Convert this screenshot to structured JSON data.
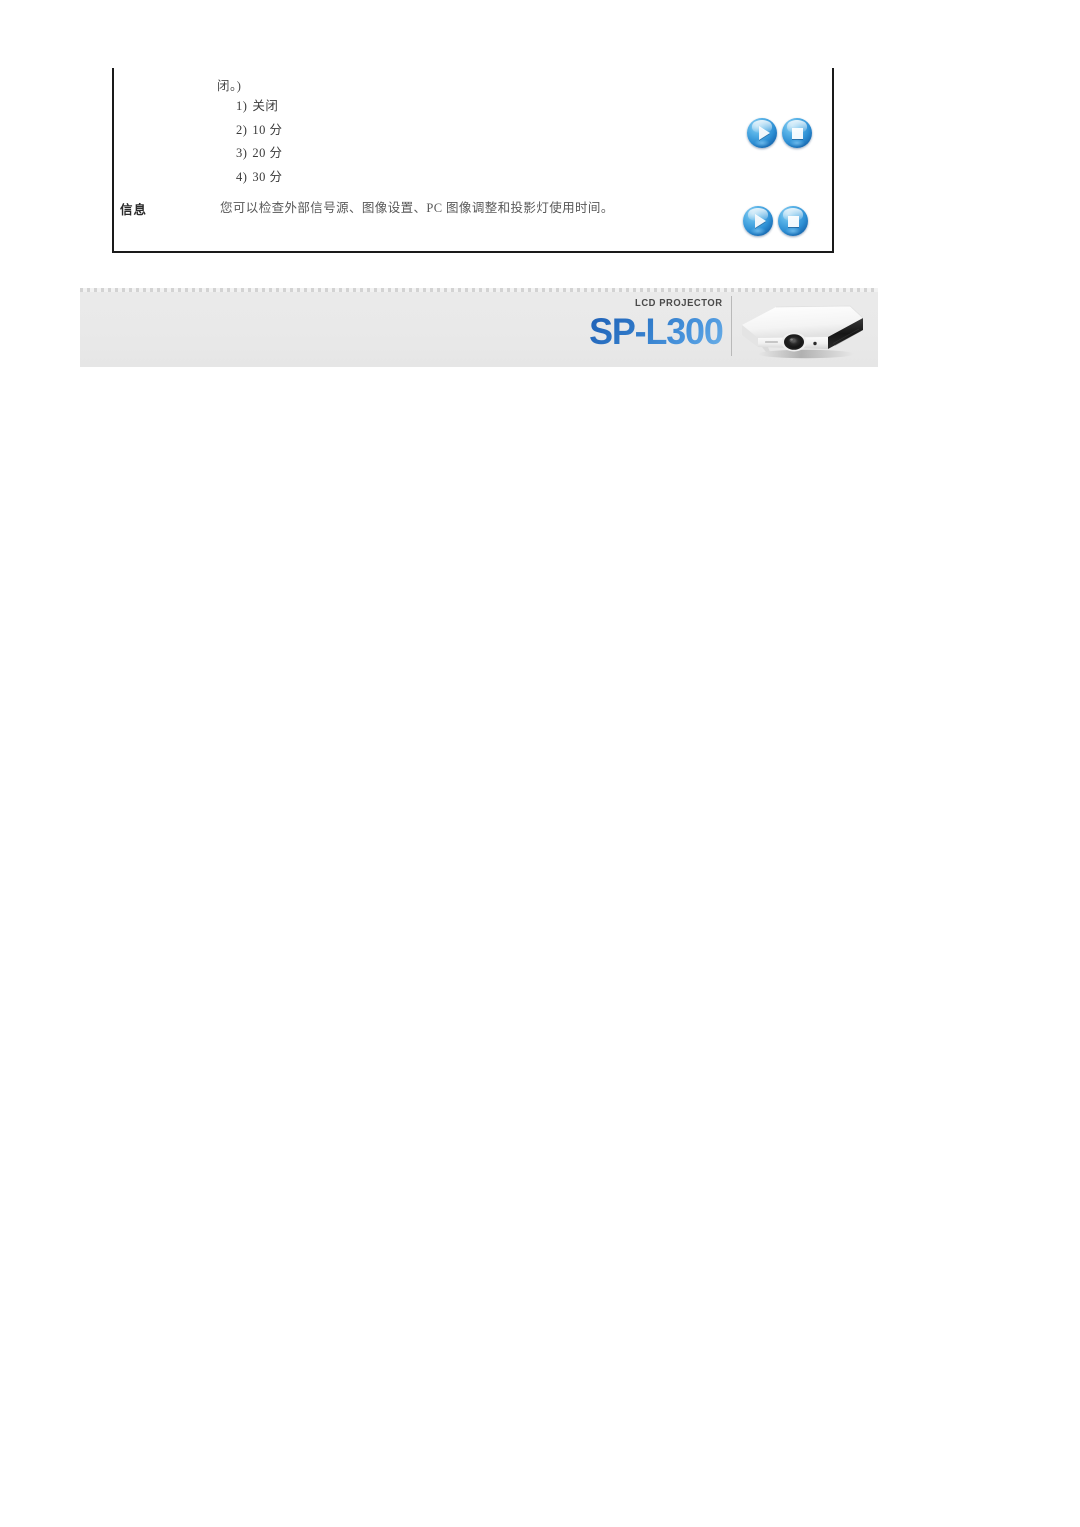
{
  "document": {
    "menu_table": {
      "continuation_text": "闭。)",
      "options": [
        {
          "num": "1)",
          "text": "关闭"
        },
        {
          "num": "2)",
          "text": "10 分"
        },
        {
          "num": "3)",
          "text": "20 分"
        },
        {
          "num": "4)",
          "text": "30 分"
        }
      ],
      "options_buttons": [
        {
          "icon": "play-triangle-icon"
        },
        {
          "icon": "stop-square-icon"
        }
      ],
      "info_row": {
        "label": "信息",
        "description": "您可以检查外部信号源、图像设置、PC 图像调整和投影灯使用时间。",
        "buttons": [
          {
            "icon": "play-triangle-icon"
          },
          {
            "icon": "stop-square-icon"
          }
        ]
      }
    },
    "footer_banner": {
      "category_label": "LCD PROJECTOR",
      "model_name": "SP-L300",
      "product_image_alt": "projector-product-photo",
      "colors": {
        "banner_background": "#e9e9e9",
        "model_name_blue": "#2f79c8",
        "divider": "#b9b9b9"
      }
    }
  }
}
